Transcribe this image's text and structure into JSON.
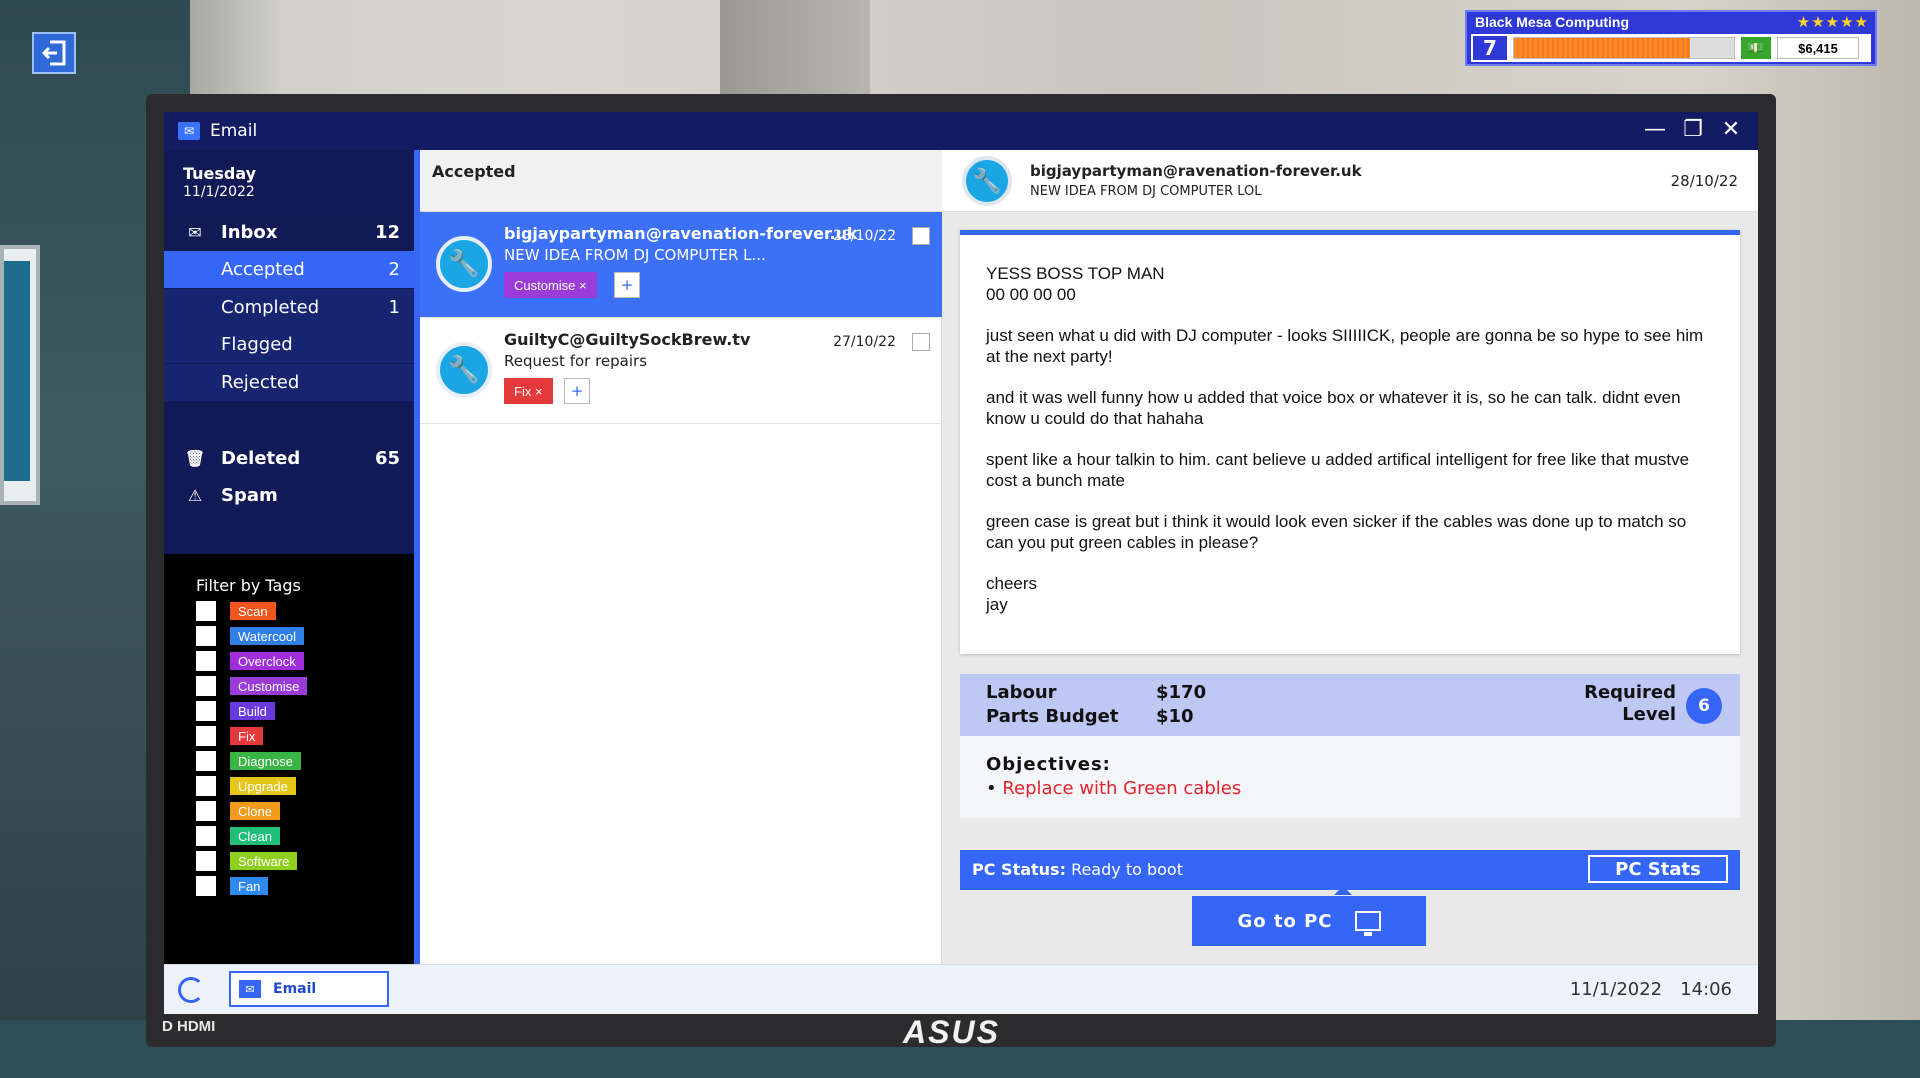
{
  "hud": {
    "company": "Black Mesa Computing",
    "stars": "★★★★★",
    "level": "7",
    "xp_fraction": 0.8,
    "money": "$6,415"
  },
  "window": {
    "title": "Email"
  },
  "sidebar": {
    "day": "Tuesday",
    "date": "11/1/2022",
    "inbox": {
      "label": "Inbox",
      "count": "12"
    },
    "folders": [
      {
        "label": "Accepted",
        "count": "2"
      },
      {
        "label": "Completed",
        "count": "1"
      },
      {
        "label": "Flagged",
        "count": ""
      },
      {
        "label": "Rejected",
        "count": ""
      }
    ],
    "deleted": {
      "label": "Deleted",
      "count": "65"
    },
    "spam": {
      "label": "Spam"
    },
    "filter_title": "Filter by Tags",
    "tags": [
      {
        "label": "Scan",
        "color": "#f0561e"
      },
      {
        "label": "Watercool",
        "color": "#2f7fe6"
      },
      {
        "label": "Overclock",
        "color": "#a22ddb"
      },
      {
        "label": "Customise",
        "color": "#9b3bd8"
      },
      {
        "label": "Build",
        "color": "#6a3ae0"
      },
      {
        "label": "Fix",
        "color": "#e5393b"
      },
      {
        "label": "Diagnose",
        "color": "#38b545"
      },
      {
        "label": "Upgrade",
        "color": "#e6c619"
      },
      {
        "label": "Clone",
        "color": "#f29a1a"
      },
      {
        "label": "Clean",
        "color": "#1fbf7a"
      },
      {
        "label": "Software",
        "color": "#8dd11e"
      },
      {
        "label": "Fan",
        "color": "#2f8af0"
      }
    ]
  },
  "list": {
    "header": "Accepted",
    "messages": [
      {
        "sender": "bigjaypartyman@ravenation-forever.uk",
        "subject": "NEW IDEA FROM DJ COMPUTER L...",
        "date": "28/10/22",
        "tag": "Customise ×",
        "tag_color": "#9b3bd8",
        "plus": "+"
      },
      {
        "sender": "GuiltyC@GuiltySockBrew.tv",
        "subject": "Request for repairs",
        "date": "27/10/22",
        "tag": "Fix ×",
        "tag_color": "#e5393b",
        "plus": "+"
      }
    ]
  },
  "reader": {
    "sender": "bigjaypartyman@ravenation-forever.uk",
    "subject": "NEW IDEA FROM DJ COMPUTER LOL",
    "date": "28/10/22",
    "body": [
      "YESS BOSS TOP MAN\n00 00 00 00",
      "just seen what u did with DJ computer - looks SIIIIICK, people are gonna be so hype to see him at the next party!",
      "and it was well funny how u added that voice box or whatever it is, so he can talk. didnt even know u could do that hahaha",
      "spent like a hour talkin to him. cant believe u added artifical intelligent for free like that mustve cost a bunch mate",
      "green case is great but i think it would look even sicker if the cables was done up to match so can you put green cables in please?",
      "cheers\njay"
    ],
    "labour_label": "Labour",
    "labour_value": "$170",
    "parts_label": "Parts Budget",
    "parts_value": "$10",
    "required_label": "Required",
    "level_label": "Level",
    "required_level": "6",
    "objectives_title": "Objectives:",
    "objective": "Replace with Green cables",
    "status_label": "PC Status:",
    "status_value": "Ready to boot",
    "stats_button": "PC Stats",
    "goto_button": "Go to PC"
  },
  "taskbar": {
    "email_label": "Email",
    "date": "11/1/2022",
    "time": "14:06"
  },
  "monitor": {
    "brand": "ASUS",
    "hdmi": "D HDMI"
  }
}
